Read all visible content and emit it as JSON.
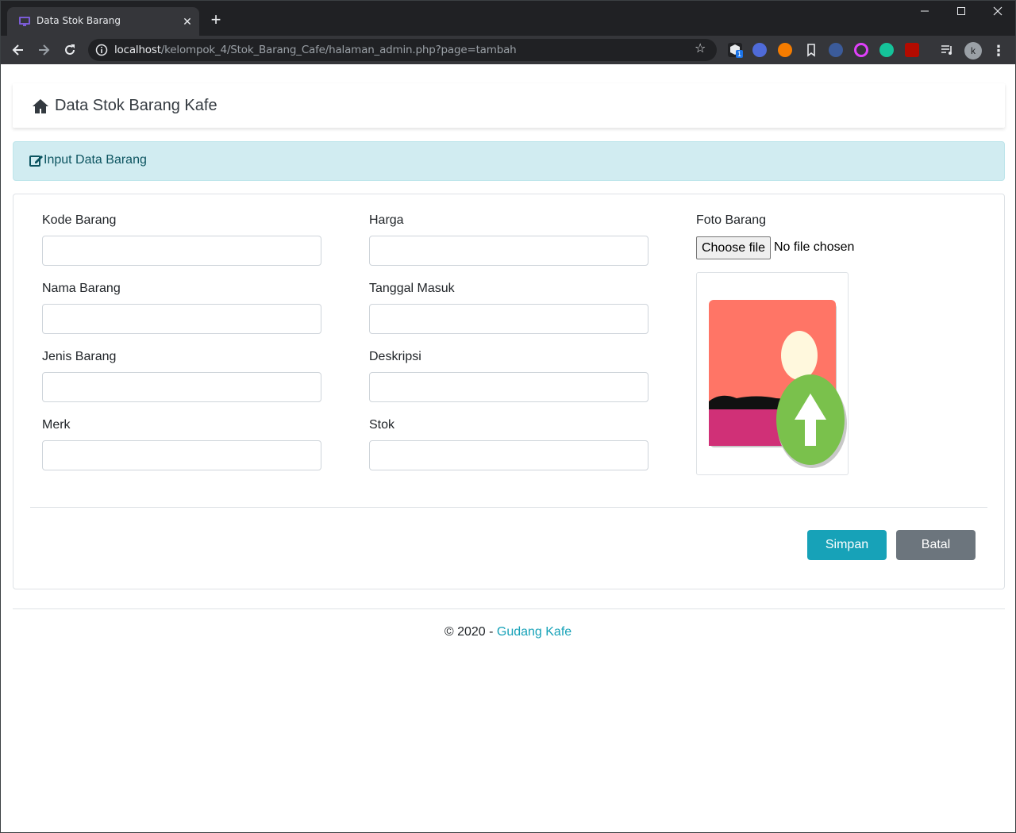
{
  "browser": {
    "tab_title": "Data Stok Barang",
    "url_host": "localhost",
    "url_path": "/kelompok_4/Stok_Barang_Cafe/halaman_admin.php?page=tambah",
    "extension_badge": "1",
    "profile_initial": "k"
  },
  "navbar": {
    "brand": "Data Stok Barang Kafe"
  },
  "alert": {
    "text": "Input Data Barang"
  },
  "form": {
    "kode_barang": {
      "label": "Kode Barang",
      "value": ""
    },
    "nama_barang": {
      "label": "Nama Barang",
      "value": ""
    },
    "jenis_barang": {
      "label": "Jenis Barang",
      "value": ""
    },
    "merk": {
      "label": "Merk",
      "value": ""
    },
    "harga": {
      "label": "Harga",
      "value": ""
    },
    "tanggal_masuk": {
      "label": "Tanggal Masuk",
      "value": ""
    },
    "deskripsi": {
      "label": "Deskripsi",
      "value": ""
    },
    "stok": {
      "label": "Stok",
      "value": ""
    },
    "foto": {
      "label": "Foto Barang",
      "button": "Choose file",
      "status": "No file chosen"
    }
  },
  "buttons": {
    "save": "Simpan",
    "cancel": "Batal"
  },
  "footer": {
    "copyright": "© 2020 - ",
    "link": "Gudang Kafe"
  },
  "colors": {
    "primary_info": "#17a2b8",
    "secondary": "#6c757d",
    "alert_bg": "#d1ecf1",
    "alert_text": "#0c5460"
  }
}
